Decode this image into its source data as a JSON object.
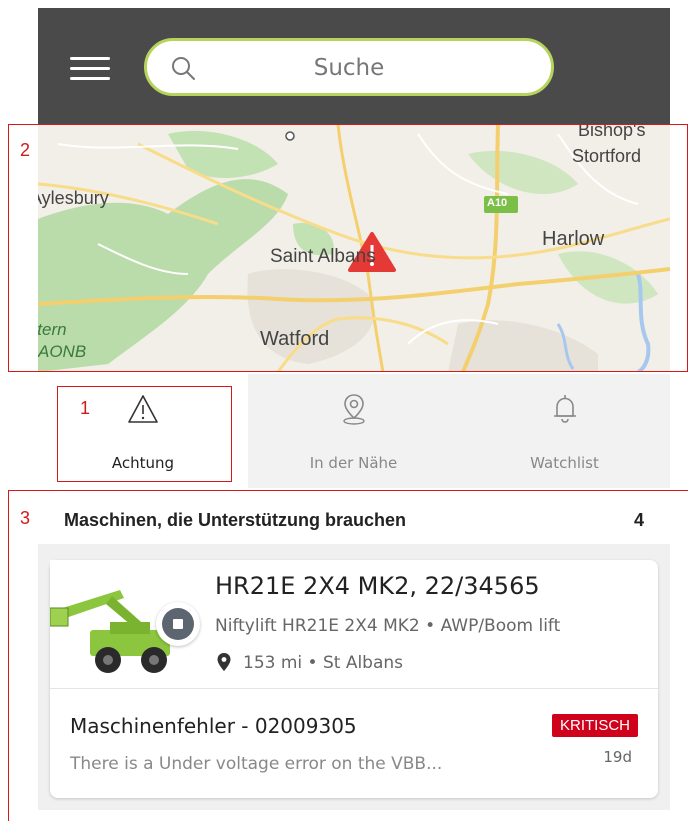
{
  "header": {
    "menu_icon": "hamburger-icon",
    "search": {
      "placeholder": "Suche",
      "icon": "search-icon",
      "border_color": "#b6d45c"
    },
    "background": "#4a4a4a"
  },
  "map": {
    "labels": [
      "Bishop's",
      "Stortford",
      "Aylesbury",
      "Harlow",
      "Saint Albans",
      "Watford",
      "Chiltern",
      "AONB",
      "A10"
    ],
    "alert_icon": "warning-triangle-icon",
    "alert_color": "#e53935"
  },
  "annotations": [
    "1",
    "2",
    "3"
  ],
  "tabs": [
    {
      "label": "Achtung",
      "icon": "warning-outline-icon",
      "active": true
    },
    {
      "label": "In der Nähe",
      "icon": "location-pin-icon",
      "active": false
    },
    {
      "label": "Watchlist",
      "icon": "bell-icon",
      "active": false
    }
  ],
  "list": {
    "title": "Maschinen, die Unterstützung brauchen",
    "count": "4",
    "card": {
      "name": "HR21E 2X4 MK2, 22/34565",
      "model": "Niftylift HR21E 2X4 MK2 • AWP/Boom lift",
      "location": "153 mi • St Albans",
      "fault_title": "Maschinenfehler - 02009305",
      "fault_desc": "There is a Under voltage error on the VBB...",
      "severity": "KRITISCH",
      "severity_color": "#d0021b",
      "age": "19d",
      "status_icon": "stop-icon"
    }
  }
}
